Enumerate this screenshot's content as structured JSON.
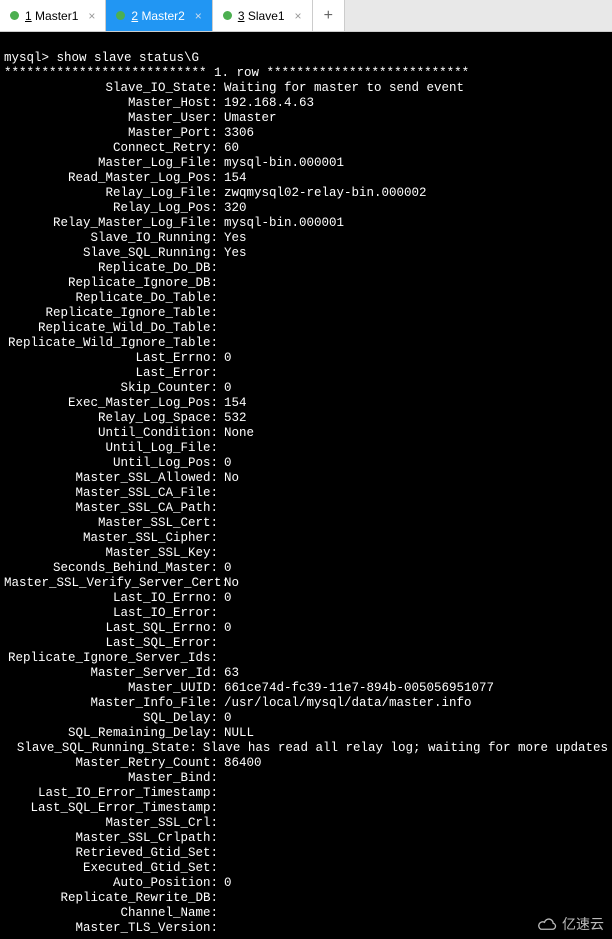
{
  "tabs": [
    {
      "num": "1",
      "name": "Master1",
      "active": false,
      "dotColor": "#4CAF50"
    },
    {
      "num": "2",
      "name": "Master2",
      "active": true,
      "dotColor": "#4CAF50"
    },
    {
      "num": "3",
      "name": "Slave1",
      "active": false,
      "dotColor": "#4CAF50"
    }
  ],
  "terminal": {
    "prompt": "mysql> show slave status\\G",
    "row_header": "*************************** 1. row ***************************",
    "fields": [
      {
        "key": "Slave_IO_State",
        "val": "Waiting for master to send event"
      },
      {
        "key": "Master_Host",
        "val": "192.168.4.63"
      },
      {
        "key": "Master_User",
        "val": "Umaster"
      },
      {
        "key": "Master_Port",
        "val": "3306"
      },
      {
        "key": "Connect_Retry",
        "val": "60"
      },
      {
        "key": "Master_Log_File",
        "val": "mysql-bin.000001"
      },
      {
        "key": "Read_Master_Log_Pos",
        "val": "154"
      },
      {
        "key": "Relay_Log_File",
        "val": "zwqmysql02-relay-bin.000002"
      },
      {
        "key": "Relay_Log_Pos",
        "val": "320"
      },
      {
        "key": "Relay_Master_Log_File",
        "val": "mysql-bin.000001"
      },
      {
        "key": "Slave_IO_Running",
        "val": "Yes"
      },
      {
        "key": "Slave_SQL_Running",
        "val": "Yes"
      },
      {
        "key": "Replicate_Do_DB",
        "val": ""
      },
      {
        "key": "Replicate_Ignore_DB",
        "val": ""
      },
      {
        "key": "Replicate_Do_Table",
        "val": ""
      },
      {
        "key": "Replicate_Ignore_Table",
        "val": ""
      },
      {
        "key": "Replicate_Wild_Do_Table",
        "val": ""
      },
      {
        "key": "Replicate_Wild_Ignore_Table",
        "val": ""
      },
      {
        "key": "Last_Errno",
        "val": "0"
      },
      {
        "key": "Last_Error",
        "val": ""
      },
      {
        "key": "Skip_Counter",
        "val": "0"
      },
      {
        "key": "Exec_Master_Log_Pos",
        "val": "154"
      },
      {
        "key": "Relay_Log_Space",
        "val": "532"
      },
      {
        "key": "Until_Condition",
        "val": "None"
      },
      {
        "key": "Until_Log_File",
        "val": ""
      },
      {
        "key": "Until_Log_Pos",
        "val": "0"
      },
      {
        "key": "Master_SSL_Allowed",
        "val": "No"
      },
      {
        "key": "Master_SSL_CA_File",
        "val": ""
      },
      {
        "key": "Master_SSL_CA_Path",
        "val": ""
      },
      {
        "key": "Master_SSL_Cert",
        "val": ""
      },
      {
        "key": "Master_SSL_Cipher",
        "val": ""
      },
      {
        "key": "Master_SSL_Key",
        "val": ""
      },
      {
        "key": "Seconds_Behind_Master",
        "val": "0"
      },
      {
        "key": "Master_SSL_Verify_Server_Cert",
        "val": "No"
      },
      {
        "key": "Last_IO_Errno",
        "val": "0"
      },
      {
        "key": "Last_IO_Error",
        "val": ""
      },
      {
        "key": "Last_SQL_Errno",
        "val": "0"
      },
      {
        "key": "Last_SQL_Error",
        "val": ""
      },
      {
        "key": "Replicate_Ignore_Server_Ids",
        "val": ""
      },
      {
        "key": "Master_Server_Id",
        "val": "63"
      },
      {
        "key": "Master_UUID",
        "val": "661ce74d-fc39-11e7-894b-005056951077"
      },
      {
        "key": "Master_Info_File",
        "val": "/usr/local/mysql/data/master.info"
      },
      {
        "key": "SQL_Delay",
        "val": "0"
      },
      {
        "key": "SQL_Remaining_Delay",
        "val": "NULL"
      },
      {
        "key": "Slave_SQL_Running_State",
        "val": "Slave has read all relay log; waiting for more updates"
      },
      {
        "key": "Master_Retry_Count",
        "val": "86400"
      },
      {
        "key": "Master_Bind",
        "val": ""
      },
      {
        "key": "Last_IO_Error_Timestamp",
        "val": ""
      },
      {
        "key": "Last_SQL_Error_Timestamp",
        "val": ""
      },
      {
        "key": "Master_SSL_Crl",
        "val": ""
      },
      {
        "key": "Master_SSL_Crlpath",
        "val": ""
      },
      {
        "key": "Retrieved_Gtid_Set",
        "val": ""
      },
      {
        "key": "Executed_Gtid_Set",
        "val": ""
      },
      {
        "key": "Auto_Position",
        "val": "0"
      },
      {
        "key": "Replicate_Rewrite_DB",
        "val": ""
      },
      {
        "key": "Channel_Name",
        "val": ""
      },
      {
        "key": "Master_TLS_Version",
        "val": ""
      }
    ]
  },
  "watermark": {
    "text": "亿速云"
  }
}
